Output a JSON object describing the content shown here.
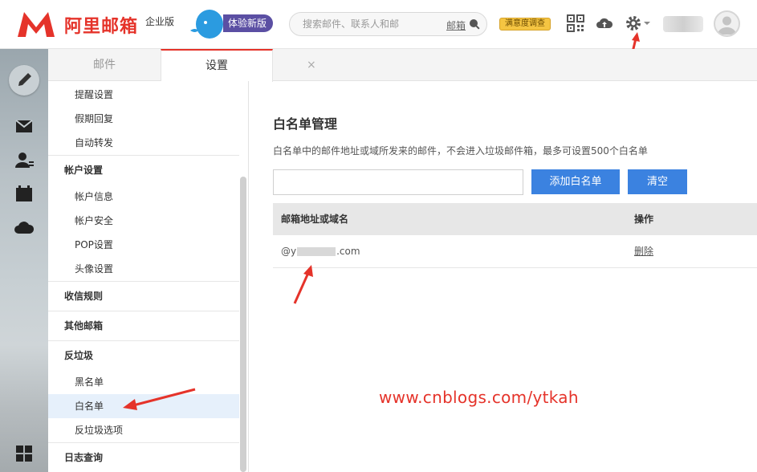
{
  "header": {
    "logo_text": "阿里邮箱",
    "edition": "企业版",
    "try_new": "体验新版",
    "search_placeholder": "搜索邮件、联系人和邮",
    "search_scope": "邮箱",
    "survey": "满意度调查",
    "icons": [
      "qrcode-icon",
      "cloud-upload-icon",
      "gear-icon",
      "avatar-icon"
    ]
  },
  "tabs": [
    {
      "label": "邮件"
    },
    {
      "label": "设置"
    }
  ],
  "tab_close": "×",
  "menu": {
    "items_top": [
      "提醒设置",
      "假期回复",
      "自动转发"
    ],
    "group_account": "帐户设置",
    "account_items": [
      "帐户信息",
      "帐户安全",
      "POP设置",
      "头像设置"
    ],
    "group_rules": "收信规则",
    "group_other": "其他邮箱",
    "group_spam": "反垃圾",
    "spam_items": [
      "黑名单",
      "白名单",
      "反垃圾选项"
    ],
    "group_log": "日志查询"
  },
  "whitelist": {
    "title": "白名单管理",
    "description": "白名单中的邮件地址或域所发来的邮件，不会进入垃圾邮件箱，最多可设置500个白名单",
    "input_value": "",
    "add_button": "添加白名单",
    "clear_button": "清空",
    "columns": [
      "邮箱地址或域名",
      "操作"
    ],
    "rows": [
      {
        "address_prefix": "@y",
        "address_suffix": ".com",
        "action": "删除"
      }
    ]
  },
  "watermark": "www.cnblogs.com/ytkah",
  "colors": {
    "brand_red": "#e5332a",
    "button_blue": "#3b82e0",
    "active_menu": "#e6f0fb"
  }
}
